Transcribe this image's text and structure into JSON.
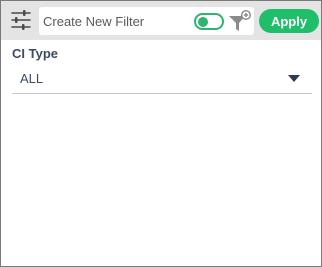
{
  "toolbar": {
    "filter_settings_icon": "sliders-icon",
    "filter_input": {
      "value": "",
      "placeholder": "Create New Filter"
    },
    "toggle_state": "on",
    "add_filter_icon": "filter-plus-icon",
    "apply_label": "Apply"
  },
  "form": {
    "ci_type": {
      "label": "CI Type",
      "selected": "ALL"
    }
  },
  "colors": {
    "toolbar_bg": "#e4e4e4",
    "accent_green": "#1fbf6a",
    "label_text": "#3d4a66",
    "border": "#7a7a7a"
  }
}
